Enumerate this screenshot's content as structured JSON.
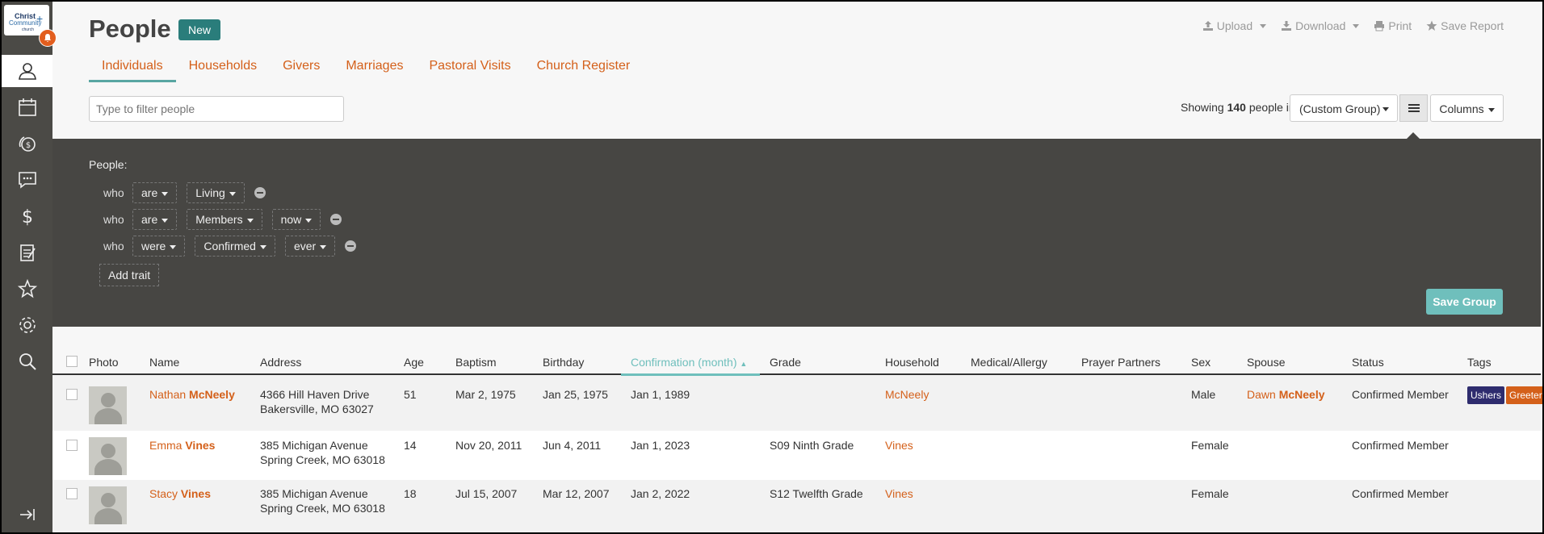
{
  "logo": {
    "line1": "Christ",
    "line2": "Community",
    "line3": "church"
  },
  "header": {
    "title": "People",
    "new_label": "New"
  },
  "toplinks": {
    "upload": "Upload",
    "download": "Download",
    "print": "Print",
    "save_report": "Save Report"
  },
  "tabs": [
    "Individuals",
    "Households",
    "Givers",
    "Marriages",
    "Pastoral Visits",
    "Church Register"
  ],
  "filter": {
    "placeholder": "Type to filter people"
  },
  "showing": {
    "prefix": "Showing",
    "count": "140",
    "suffix": "people in"
  },
  "group_select": "(Custom Group)",
  "columns_label": "Columns",
  "panel": {
    "label": "People:",
    "traits": [
      {
        "who": "who",
        "verb": "are",
        "value": "Living",
        "time": ""
      },
      {
        "who": "who",
        "verb": "are",
        "value": "Members",
        "time": "now"
      },
      {
        "who": "who",
        "verb": "were",
        "value": "Confirmed",
        "time": "ever"
      }
    ],
    "add_trait": "Add trait",
    "save_group": "Save Group"
  },
  "table": {
    "headers": [
      "Photo",
      "Name",
      "Address",
      "Age",
      "Baptism",
      "Birthday",
      "Confirmation (month)",
      "Grade",
      "Household",
      "Medical/Allergy",
      "Prayer Partners",
      "Sex",
      "Spouse",
      "Status",
      "Tags"
    ],
    "rows": [
      {
        "first": "Nathan",
        "last": "McNeely",
        "addr1": "4366 Hill Haven Drive",
        "addr2": "Bakersville, MO  63027",
        "age": "51",
        "baptism": "Mar 2, 1975",
        "birthday": "Jan 25, 1975",
        "confirmation": "Jan 1, 1989",
        "grade": "",
        "household": "McNeely",
        "sex": "Male",
        "spouse_first": "Dawn",
        "spouse_last": "McNeely",
        "status": "Confirmed Member",
        "tags": [
          "Ushers",
          "Greeter"
        ]
      },
      {
        "first": "Emma",
        "last": "Vines",
        "addr1": "385 Michigan Avenue",
        "addr2": "Spring Creek, MO  63018",
        "age": "14",
        "baptism": "Nov 20, 2011",
        "birthday": "Jun 4, 2011",
        "confirmation": "Jan 1, 2023",
        "grade": "S09 Ninth Grade",
        "household": "Vines",
        "sex": "Female",
        "spouse_first": "",
        "spouse_last": "",
        "status": "Confirmed Member",
        "tags": []
      },
      {
        "first": "Stacy",
        "last": "Vines",
        "addr1": "385 Michigan Avenue",
        "addr2": "Spring Creek, MO  63018",
        "age": "18",
        "baptism": "Jul 15, 2007",
        "birthday": "Mar 12, 2007",
        "confirmation": "Jan 2, 2022",
        "grade": "S12 Twelfth Grade",
        "household": "Vines",
        "sex": "Female",
        "spouse_first": "",
        "spouse_last": "",
        "status": "Confirmed Member",
        "tags": []
      }
    ]
  },
  "colors": {
    "accent": "#d4601a",
    "teal": "#2a7d7b",
    "panel": "#474643",
    "sidebar": "#4b4a46",
    "sort": "#6fbfbc",
    "tag_ushers": "#2e2c6e",
    "tag_greeter": "#d4601a"
  },
  "icons": [
    "people-icon",
    "calendar-icon",
    "giving-circle-icon",
    "chat-icon",
    "dollar-icon",
    "clipboard-icon",
    "star-icon",
    "gear-icon",
    "search-icon",
    "expand-sidebar-icon",
    "bell-icon"
  ]
}
